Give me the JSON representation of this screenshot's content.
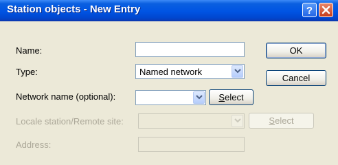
{
  "dialog": {
    "title": "Station objects - New Entry"
  },
  "fields": {
    "name_label": "Name:",
    "name_value": "",
    "type_label": "Type:",
    "type_value": "Named network",
    "network_label": "Network name (optional):",
    "network_value": "",
    "locale_label": "Locale station/Remote site:",
    "locale_value": "",
    "address_label": "Address:",
    "address_value": ""
  },
  "buttons": {
    "ok": "OK",
    "cancel": "Cancel",
    "select_first": "S",
    "select_rest": "elect",
    "select2_first": "S",
    "select2_rest": "elect"
  },
  "colors": {
    "titlebar": "#0054e3",
    "dialog_bg": "#ece9d8",
    "disabled_text": "#aca899"
  }
}
